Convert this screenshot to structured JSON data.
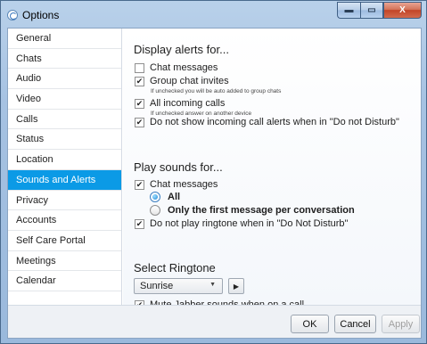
{
  "window": {
    "title": "Options",
    "minimize_glyph": "▬",
    "maximize_glyph": "▭",
    "close_glyph": "X"
  },
  "sidebar": {
    "items": [
      {
        "label": "General"
      },
      {
        "label": "Chats"
      },
      {
        "label": "Audio"
      },
      {
        "label": "Video"
      },
      {
        "label": "Calls"
      },
      {
        "label": "Status"
      },
      {
        "label": "Location"
      },
      {
        "label": "Sounds and Alerts",
        "selected": true
      },
      {
        "label": "Privacy"
      },
      {
        "label": "Accounts"
      },
      {
        "label": "Self Care Portal"
      },
      {
        "label": "Meetings"
      },
      {
        "label": "Calendar"
      }
    ]
  },
  "alerts": {
    "title": "Display alerts for...",
    "chat_messages": {
      "label": "Chat messages",
      "checked": false
    },
    "group_chat": {
      "label": "Group chat invites",
      "checked": true,
      "hint": "If unchecked you will be auto added to group chats"
    },
    "incoming_calls": {
      "label": "All incoming calls",
      "checked": true,
      "hint": "If unchecked answer on another device"
    },
    "dnd_calls": {
      "label": "Do not show incoming call alerts when in \"Do not Disturb\"",
      "checked": true
    }
  },
  "sounds": {
    "title": "Play sounds for...",
    "chat_messages": {
      "label": "Chat messages",
      "checked": true
    },
    "radio_all": {
      "label": "All",
      "selected": true
    },
    "radio_first": {
      "label": "Only the first message per conversation",
      "selected": false
    },
    "dnd_ringtone": {
      "label": "Do not play ringtone when in \"Do Not Disturb\"",
      "checked": true
    }
  },
  "ringtone": {
    "title": "Select Ringtone",
    "selected": "Sunrise",
    "caret": "▼",
    "play_glyph": "▶",
    "mute": {
      "label": "Mute Jabber sounds when on a call",
      "checked": true
    }
  },
  "footer": {
    "ok_label": "OK",
    "cancel_label": "Cancel",
    "apply_label": "Apply"
  },
  "check_glyph": "✔"
}
